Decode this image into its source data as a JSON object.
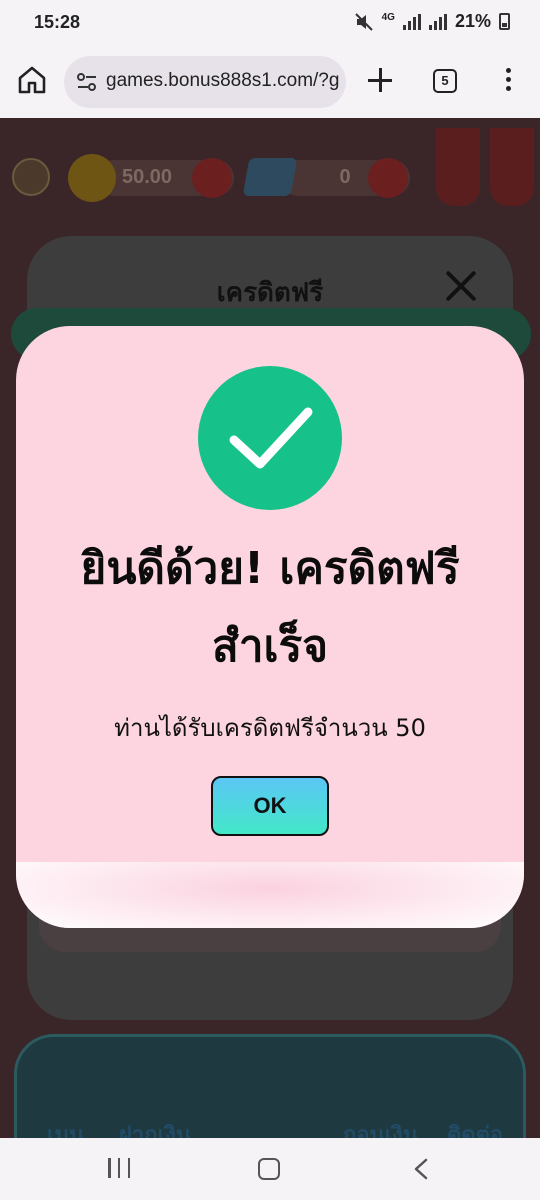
{
  "status_bar": {
    "time": "15:28",
    "network": "4G",
    "battery": "21%"
  },
  "browser": {
    "url": "games.bonus888s1.com/?g",
    "tab_count": "5"
  },
  "background_modal": {
    "title": "เครดิตฟรี"
  },
  "game_header": {
    "credit": "50.00",
    "gems": "0"
  },
  "game_nav": {
    "items": [
      "เมนู",
      "ฝากเงิน",
      "ถอนเงิน",
      "ติดต่อ"
    ]
  },
  "dialog": {
    "title_line1": "ยินดีด้วย! เครดิตฟรี",
    "title_line2": "สำเร็จ",
    "message": "ท่านได้รับเครดิตฟรีจำนวน 50",
    "ok_label": "OK"
  },
  "colors": {
    "dialog_bg": "#fdd5e0",
    "check_green": "#16c18a",
    "ok_gradient_top": "#5bc6f5",
    "ok_gradient_bottom": "#43e8c9"
  }
}
